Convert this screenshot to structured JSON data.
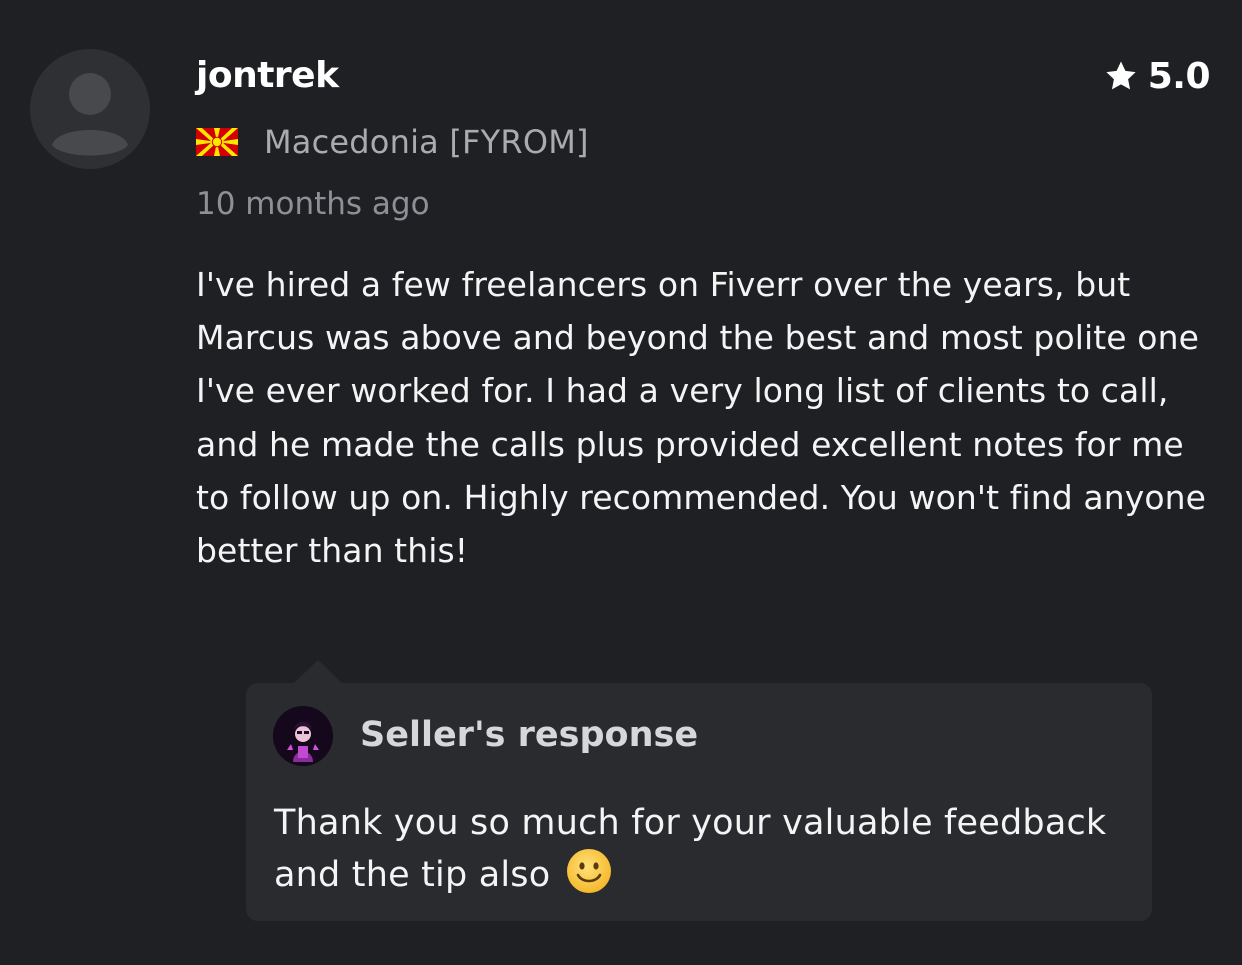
{
  "review": {
    "username": "jontrek",
    "rating": "5.0",
    "country": "Macedonia [FYROM]",
    "time_ago": "10 months ago",
    "text": "I've hired a few freelancers on Fiverr over the years, but Marcus was above and beyond the best and most polite one I've ever worked for. I had a very long list of clients to call, and he made the calls plus provided excellent notes for me to follow up on. Highly recommended. You won't find anyone better than this!"
  },
  "seller_response": {
    "title": "Seller's response",
    "text": "Thank you so much for your valuable feedback and the tip also",
    "emoji": "slightly-smiling-face-icon"
  },
  "icons": {
    "avatar": "default-user-avatar-icon",
    "rating": "star-icon",
    "flag": "macedonia-flag-icon"
  },
  "colors": {
    "background": "#1f2023",
    "response_background": "#2a2b2e",
    "muted_text": "#a9abaf"
  }
}
